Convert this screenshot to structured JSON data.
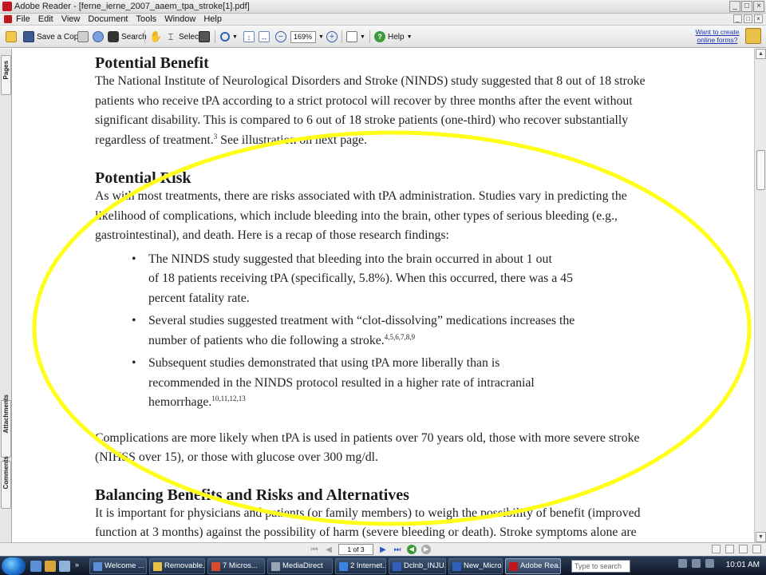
{
  "window": {
    "title": "Adobe Reader - [ferne_ierne_2007_aaem_tpa_stroke[1].pdf]",
    "controls": [
      "_",
      "□",
      "×"
    ]
  },
  "menu": [
    "File",
    "Edit",
    "View",
    "Document",
    "Tools",
    "Window",
    "Help"
  ],
  "toolbar": {
    "save_copy": "Save a Copy",
    "search": "Search",
    "select": "Select",
    "zoom": "169%",
    "help": "Help",
    "create_link": "Want to create online forms?"
  },
  "left_panel": {
    "tabs": [
      "Pages",
      "Attachments",
      "Comments"
    ]
  },
  "document": {
    "h1": "Potential Benefit",
    "p1": "The National Institute of Neurological Disorders and Stroke (NINDS) study suggested that 8 out of 18 stroke\npatients who receive tPA according to a strict protocol will recover by three months after the event without\nsignificant disability.  This is compared to 6 out of 18 stroke patients (one-third) who recover substantially\nregardless of treatment.",
    "p1_sup": "3",
    "p1_tail": " See illustration on next page.",
    "h2": "Potential Risk",
    "p2": "As with most treatments, there are risks associated with tPA administration. Studies vary in predicting the\nlikelihood of complications, which include bleeding into the brain, other types of serious bleeding (e.g.,\ngastrointestinal), and death.  Here is a recap of those research findings:",
    "b1": "The NINDS study suggested that bleeding into the brain occurred in about 1 out\nof 18 patients receiving tPA (specifically, 5.8%). When this occurred, there was a 45\npercent fatality rate.",
    "b2": "Several studies suggested treatment with “clot-dissolving” medications increases the\nnumber of patients who die following a stroke.",
    "b2_sup": "4,5,6,7,8,9",
    "b3": "Subsequent studies demonstrated that using tPA more liberally than is\nrecommended in the NINDS protocol resulted in a higher rate of intracranial\nhemorrhage.",
    "b3_sup": "10,11,12,13",
    "p3": "Complications are more likely when tPA is used in patients over 70 years old, those with more severe stroke\n(NIHSS over 15), or those with glucose over 300 mg/dl.",
    "h3": "Balancing Benefits and Risks and Alternatives",
    "p4": "It is important for physicians and patients (or family members) to weigh the possibility of benefit (improved\nfunction at 3 months) against the possibility of harm (severe bleeding or death). Stroke symptoms alone are\ninsufficent to definitely diagnose stroke and, in patients with a stroke mimic, tPA use results only in potential"
  },
  "annotation": {
    "color": "#ffff1a"
  },
  "statusbar": {
    "page": "1 of 3"
  },
  "taskbar": {
    "tasks": [
      {
        "label": "Welcome ...",
        "color": "#5a8fd6"
      },
      {
        "label": "Removable...",
        "color": "#e7c34a"
      },
      {
        "label": "7 Micros...",
        "color": "#d84a2a"
      },
      {
        "label": "MediaDirect",
        "color": "#9aa6b6"
      },
      {
        "label": "2 Internet...",
        "color": "#3b82e0"
      },
      {
        "label": "Dclnb_INJU...",
        "color": "#2f5fb8"
      },
      {
        "label": "New_Micro...",
        "color": "#2f5fb8"
      },
      {
        "label": "Adobe Rea...",
        "color": "#c0161d",
        "active": true
      }
    ],
    "search_placeholder": "Type to search",
    "time": "10:01 AM"
  }
}
